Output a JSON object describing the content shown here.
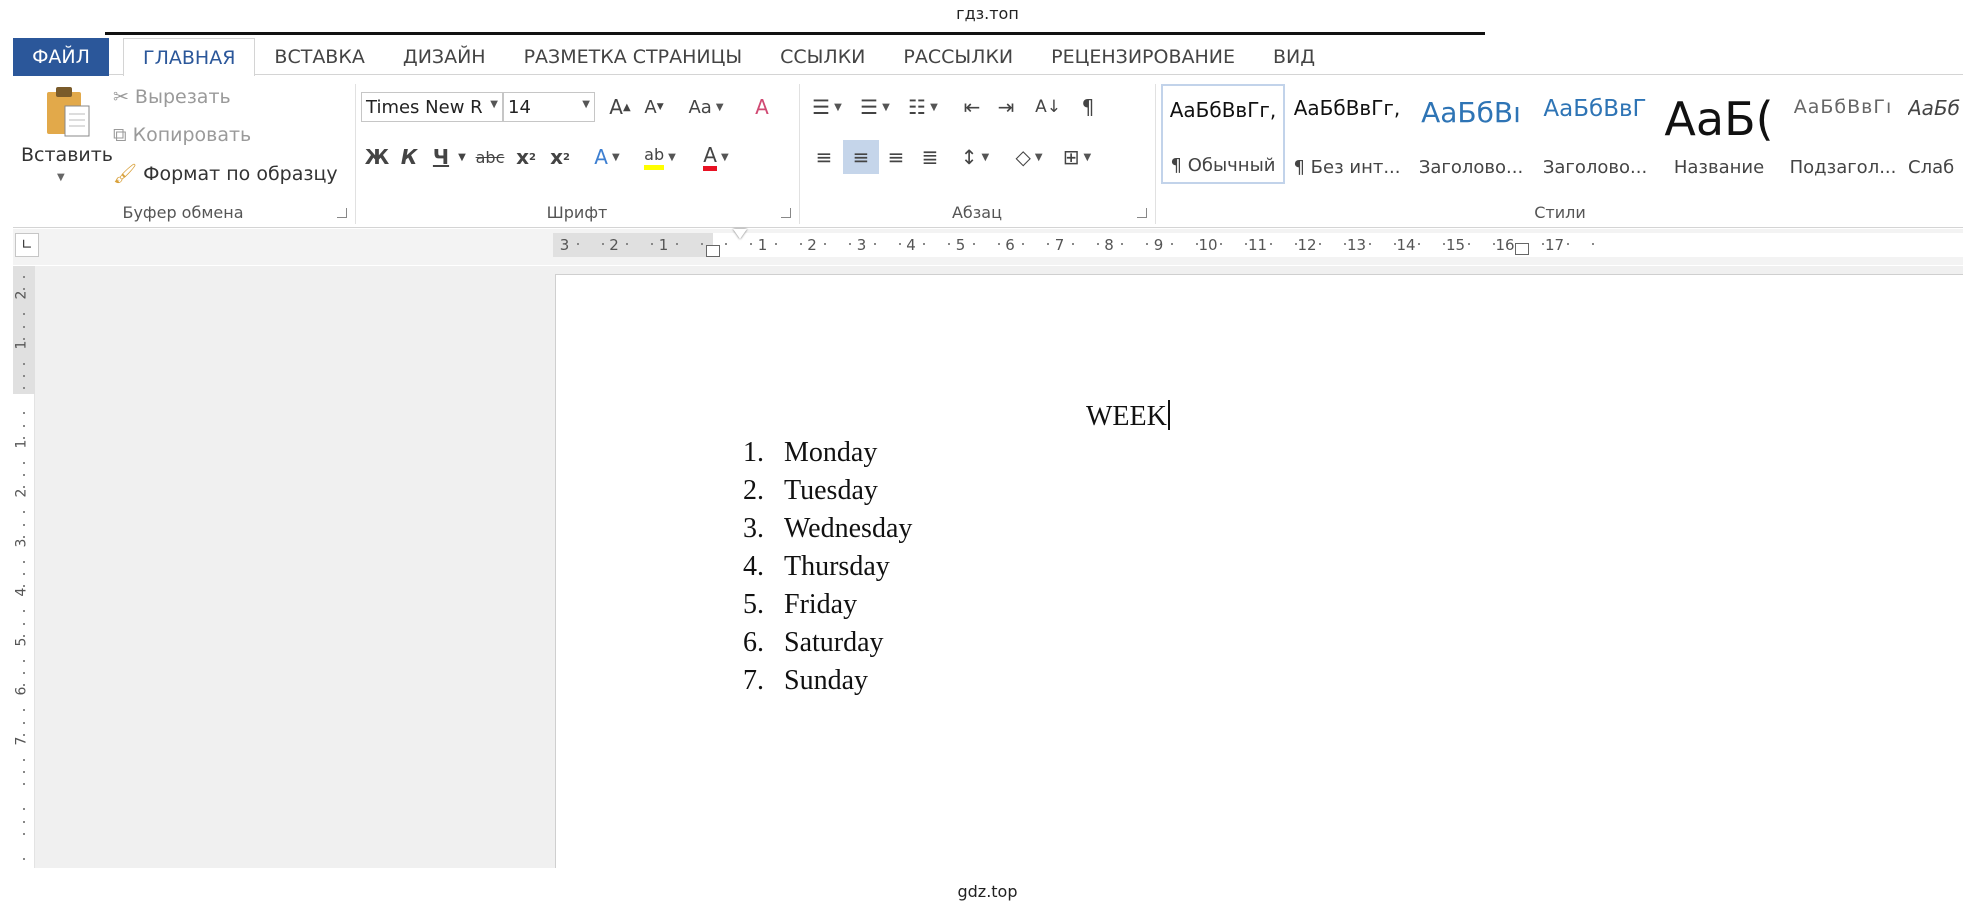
{
  "watermark_top": "гдз.топ",
  "watermark_bottom": "gdz.top",
  "tabs": {
    "file": "ФАЙЛ",
    "items": [
      "ГЛАВНАЯ",
      "ВСТАВКА",
      "ДИЗАЙН",
      "РАЗМЕТКА СТРАНИЦЫ",
      "ССЫЛКИ",
      "РАССЫЛКИ",
      "РЕЦЕНЗИРОВАНИЕ",
      "ВИД"
    ],
    "active": "ГЛАВНАЯ"
  },
  "clipboard": {
    "paste": "Вставить",
    "cut": "Вырезать",
    "copy": "Копировать",
    "format_painter": "Формат по образцу",
    "label": "Буфер обмена"
  },
  "font": {
    "name": "Times New R",
    "size": "14",
    "label": "Шрифт",
    "bold": "Ж",
    "italic": "К",
    "underline": "Ч",
    "strike": "abc",
    "change_case": "Aa"
  },
  "paragraph": {
    "label": "Абзац"
  },
  "styles": {
    "label": "Стили",
    "items": [
      {
        "preview": "АаБбВвГг,",
        "name": "¶ Обычный"
      },
      {
        "preview": "АаБбВвГг,",
        "name": "¶ Без инт..."
      },
      {
        "preview": "АаБбВı",
        "name": "Заголово..."
      },
      {
        "preview": "АаБбВвГ",
        "name": "Заголово..."
      },
      {
        "preview": "АаБ(",
        "name": "Название"
      },
      {
        "preview": "АаБбВвГı",
        "name": "Подзагол..."
      },
      {
        "preview": "АаБб",
        "name": "Слаб"
      }
    ]
  },
  "ruler": {
    "left_numbers": [
      "3",
      "2",
      "1"
    ],
    "right_numbers": [
      "1",
      "2",
      "3",
      "4",
      "5",
      "6",
      "7",
      "8",
      "9",
      "10",
      "11",
      "12",
      "13",
      "14",
      "15",
      "16",
      "17"
    ],
    "vertical_numbers": [
      "2",
      "1",
      "1",
      "2",
      "3",
      "4",
      "5",
      "6",
      "7"
    ]
  },
  "document": {
    "title": "WEEK",
    "list": [
      {
        "num": "1.",
        "text": "Monday"
      },
      {
        "num": "2.",
        "text": "Tuesday"
      },
      {
        "num": "3.",
        "text": "Wednesday"
      },
      {
        "num": "4.",
        "text": "Thursday"
      },
      {
        "num": "5.",
        "text": "Friday"
      },
      {
        "num": "6.",
        "text": "Saturday"
      },
      {
        "num": "7.",
        "text": "Sunday"
      }
    ]
  },
  "colors": {
    "accent": "#2b579a",
    "selected_button": "#c5d5ea",
    "highlight_yellow": "#ffff00",
    "font_color_red": "#e81123"
  }
}
